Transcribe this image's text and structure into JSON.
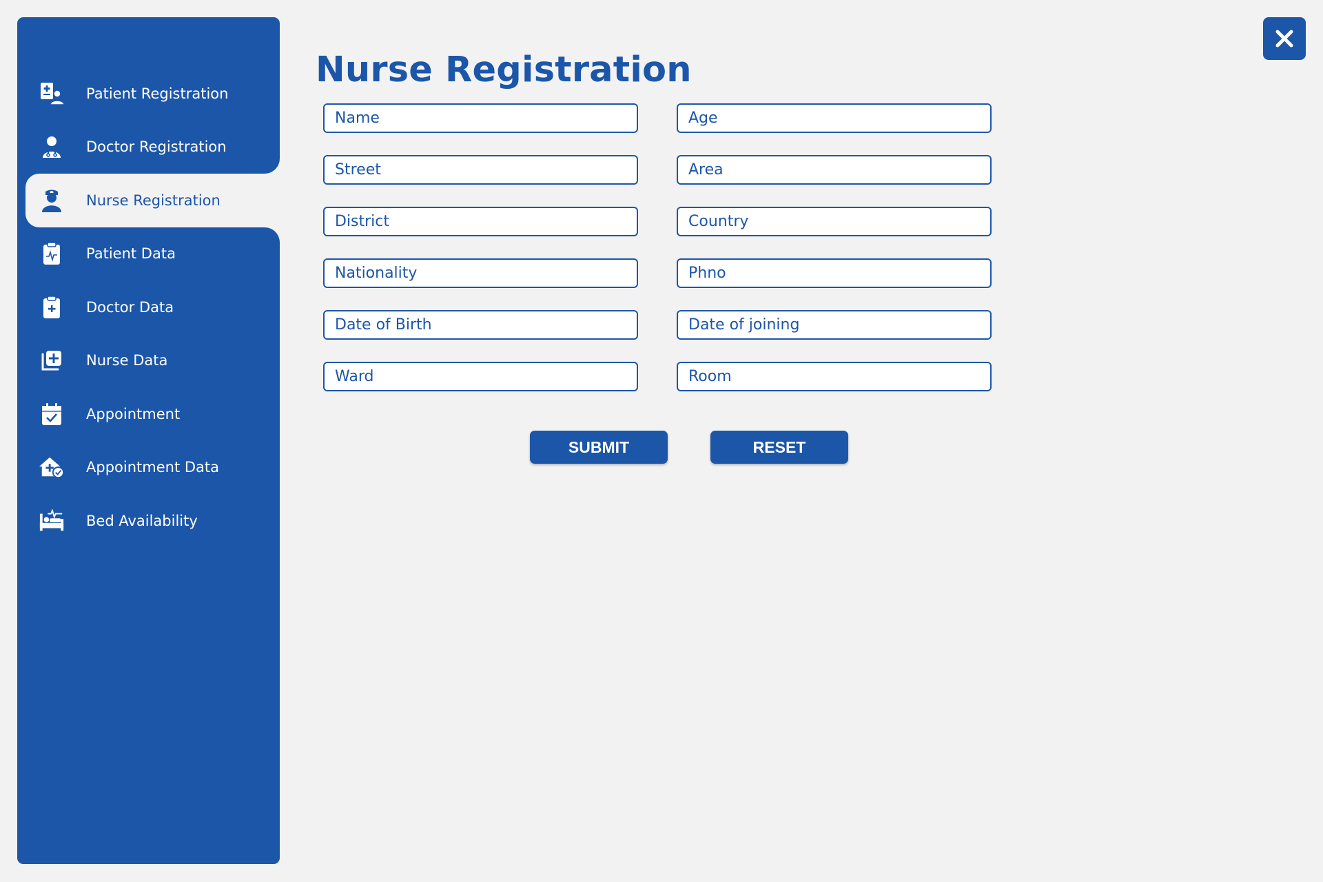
{
  "window": {
    "title": "Nurse Registration",
    "accent_color": "#1c56a8",
    "background_color": "#f2f2f2",
    "close_icon": "close-icon"
  },
  "sidebar": {
    "items": [
      {
        "label": "Patient Registration",
        "icon": "patient-registration-icon",
        "active": false
      },
      {
        "label": "Doctor Registration",
        "icon": "doctor-icon",
        "active": false
      },
      {
        "label": "Nurse Registration",
        "icon": "nurse-icon",
        "active": true
      },
      {
        "label": "Patient Data",
        "icon": "clipboard-pulse-icon",
        "active": false
      },
      {
        "label": "Doctor Data",
        "icon": "clipboard-plus-icon",
        "active": false
      },
      {
        "label": "Nurse Data",
        "icon": "medical-copy-icon",
        "active": false
      },
      {
        "label": "Appointment",
        "icon": "calendar-check-icon",
        "active": false
      },
      {
        "label": "Appointment Data",
        "icon": "house-medical-check-icon",
        "active": false
      },
      {
        "label": "Bed Availability",
        "icon": "bed-pulse-icon",
        "active": false
      }
    ]
  },
  "form": {
    "fields": [
      {
        "placeholder": "Name",
        "value": ""
      },
      {
        "placeholder": "Age",
        "value": ""
      },
      {
        "placeholder": "Street",
        "value": ""
      },
      {
        "placeholder": "Area",
        "value": ""
      },
      {
        "placeholder": "District",
        "value": ""
      },
      {
        "placeholder": "Country",
        "value": ""
      },
      {
        "placeholder": "Nationality",
        "value": ""
      },
      {
        "placeholder": "Phno",
        "value": ""
      },
      {
        "placeholder": "Date of Birth",
        "value": ""
      },
      {
        "placeholder": "Date of joining",
        "value": ""
      },
      {
        "placeholder": "Ward",
        "value": ""
      },
      {
        "placeholder": "Room",
        "value": ""
      }
    ],
    "submit_label": "SUBMIT",
    "reset_label": "RESET"
  }
}
